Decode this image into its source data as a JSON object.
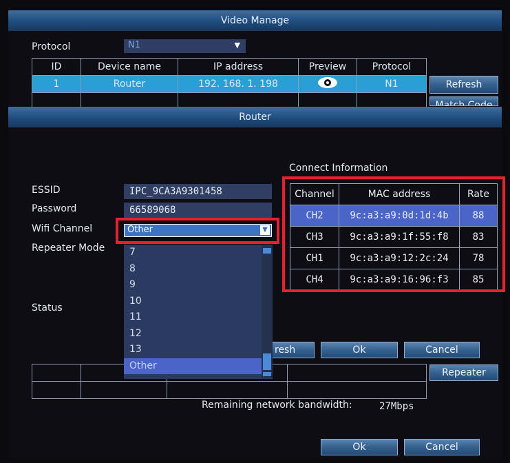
{
  "video_manage": {
    "title": "Video Manage",
    "protocol_label": "Protocol",
    "protocol_value": "N1",
    "table_headers": [
      "ID",
      "Device name",
      "IP address",
      "Preview",
      "Protocol"
    ],
    "row": {
      "id": "1",
      "device": "Router",
      "ip": "192. 168. 1. 198",
      "protocol": "N1"
    },
    "refresh_label": "Refresh",
    "match_code_label": "Match Code",
    "repeater_label": "Repeater",
    "bandwidth_label": "Remaining network bandwidth:",
    "bandwidth_value": "27Mbps",
    "ok_label": "Ok",
    "cancel_label": "Cancel"
  },
  "router": {
    "title": "Router",
    "essid_label": "ESSID",
    "essid_value": "IPC_9CA3A9301458",
    "password_label": "Password",
    "password_value": "66589068",
    "wifi_channel_label": "Wifi Channel",
    "wifi_channel_value": "Other",
    "repeater_mode_label": "Repeater Mode",
    "status_label": "Status",
    "refresh_partial": "resh",
    "ok_label": "Ok",
    "cancel_label": "Cancel",
    "channel_options": [
      "7",
      "8",
      "9",
      "10",
      "11",
      "12",
      "13",
      "Other"
    ]
  },
  "connect_info": {
    "title": "Connect Information",
    "headers": [
      "Channel",
      "MAC address",
      "Rate"
    ],
    "rows": [
      {
        "channel": "CH2",
        "mac": "9c:a3:a9:0d:1d:4b",
        "rate": "88"
      },
      {
        "channel": "CH3",
        "mac": "9c:a3:a9:1f:55:f8",
        "rate": "83"
      },
      {
        "channel": "CH1",
        "mac": "9c:a3:a9:12:2c:24",
        "rate": "78"
      },
      {
        "channel": "CH4",
        "mac": "9c:a3:a9:16:96:f3",
        "rate": "85"
      }
    ]
  },
  "colors": {
    "highlight": "#4a64c8",
    "selected_row": "#2a9fd6",
    "red_annotation": "#e3212f"
  }
}
